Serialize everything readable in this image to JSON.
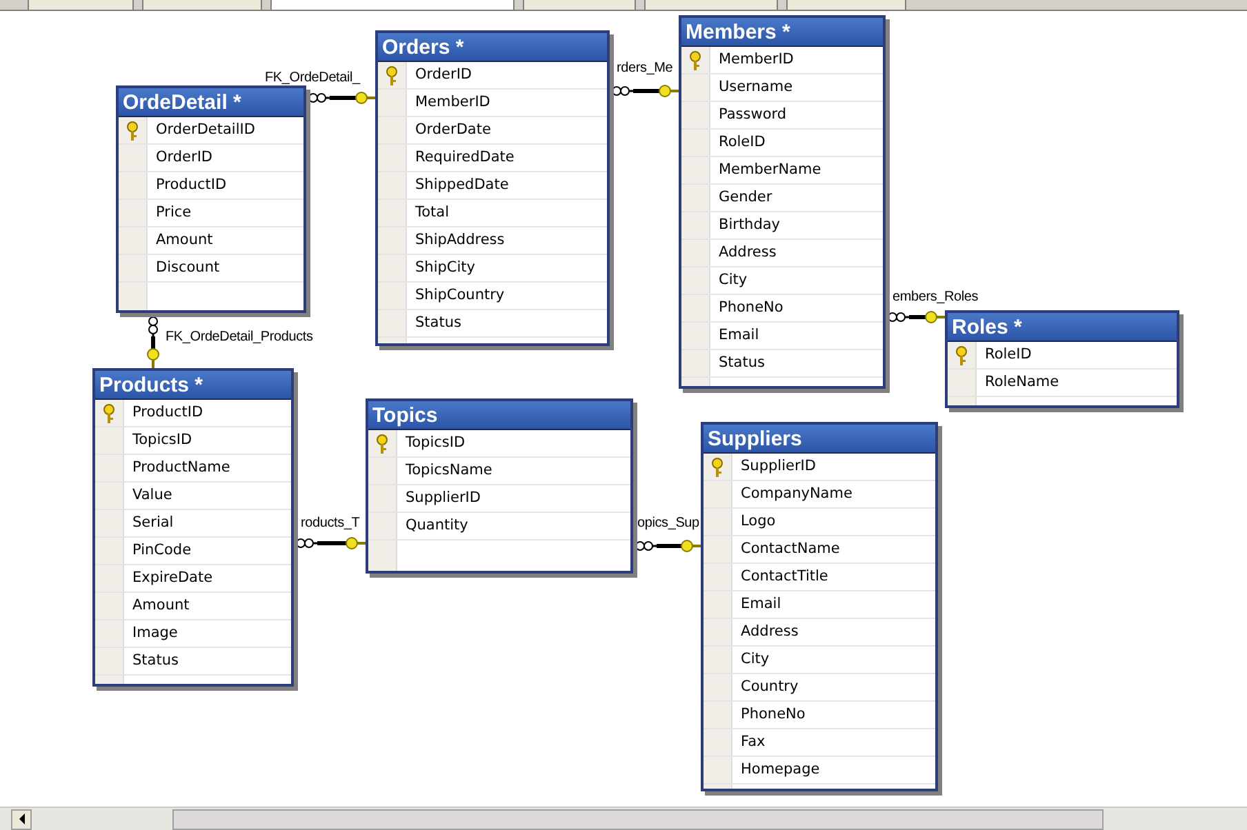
{
  "tabs": [
    {
      "selected": false
    },
    {
      "selected": false
    },
    {
      "selected": true
    },
    {
      "selected": false
    },
    {
      "selected": false
    },
    {
      "selected": false
    }
  ],
  "relationships": [
    {
      "label": "FK_OrdeDetail_"
    },
    {
      "label": "rders_Me"
    },
    {
      "label": "embers_Roles"
    },
    {
      "label": "FK_OrdeDetail_Products"
    },
    {
      "label": "roducts_T"
    },
    {
      "label": "opics_Sup"
    }
  ],
  "tables": [
    {
      "title": "OrdeDetail *",
      "columns": [
        {
          "name": "OrderDetailID",
          "key": true
        },
        {
          "name": "OrderID",
          "key": false
        },
        {
          "name": "ProductID",
          "key": false
        },
        {
          "name": "Price",
          "key": false
        },
        {
          "name": "Amount",
          "key": false
        },
        {
          "name": "Discount",
          "key": false
        }
      ]
    },
    {
      "title": "Orders *",
      "columns": [
        {
          "name": "OrderID",
          "key": true
        },
        {
          "name": "MemberID",
          "key": false
        },
        {
          "name": "OrderDate",
          "key": false
        },
        {
          "name": "RequiredDate",
          "key": false
        },
        {
          "name": "ShippedDate",
          "key": false
        },
        {
          "name": "Total",
          "key": false
        },
        {
          "name": "ShipAddress",
          "key": false
        },
        {
          "name": "ShipCity",
          "key": false
        },
        {
          "name": "ShipCountry",
          "key": false
        },
        {
          "name": "Status",
          "key": false
        }
      ]
    },
    {
      "title": "Members *",
      "columns": [
        {
          "name": "MemberID",
          "key": true
        },
        {
          "name": "Username",
          "key": false
        },
        {
          "name": "Password",
          "key": false
        },
        {
          "name": "RoleID",
          "key": false
        },
        {
          "name": "MemberName",
          "key": false
        },
        {
          "name": "Gender",
          "key": false
        },
        {
          "name": "Birthday",
          "key": false
        },
        {
          "name": "Address",
          "key": false
        },
        {
          "name": "City",
          "key": false
        },
        {
          "name": "PhoneNo",
          "key": false
        },
        {
          "name": "Email",
          "key": false
        },
        {
          "name": "Status",
          "key": false
        }
      ]
    },
    {
      "title": "Roles *",
      "columns": [
        {
          "name": "RoleID",
          "key": true
        },
        {
          "name": "RoleName",
          "key": false
        }
      ]
    },
    {
      "title": "Products *",
      "columns": [
        {
          "name": "ProductID",
          "key": true
        },
        {
          "name": "TopicsID",
          "key": false
        },
        {
          "name": "ProductName",
          "key": false
        },
        {
          "name": "Value",
          "key": false
        },
        {
          "name": "Serial",
          "key": false
        },
        {
          "name": "PinCode",
          "key": false
        },
        {
          "name": "ExpireDate",
          "key": false
        },
        {
          "name": "Amount",
          "key": false
        },
        {
          "name": "Image",
          "key": false
        },
        {
          "name": "Status",
          "key": false
        }
      ]
    },
    {
      "title": "Topics",
      "columns": [
        {
          "name": "TopicsID",
          "key": true
        },
        {
          "name": "TopicsName",
          "key": false
        },
        {
          "name": "SupplierID",
          "key": false
        },
        {
          "name": "Quantity",
          "key": false
        }
      ]
    },
    {
      "title": "Suppliers",
      "columns": [
        {
          "name": "SupplierID",
          "key": true
        },
        {
          "name": "CompanyName",
          "key": false
        },
        {
          "name": "Logo",
          "key": false
        },
        {
          "name": "ContactName",
          "key": false
        },
        {
          "name": "ContactTitle",
          "key": false
        },
        {
          "name": "Email",
          "key": false
        },
        {
          "name": "Address",
          "key": false
        },
        {
          "name": "City",
          "key": false
        },
        {
          "name": "Country",
          "key": false
        },
        {
          "name": "PhoneNo",
          "key": false
        },
        {
          "name": "Fax",
          "key": false
        },
        {
          "name": "Homepage",
          "key": false
        }
      ]
    }
  ]
}
